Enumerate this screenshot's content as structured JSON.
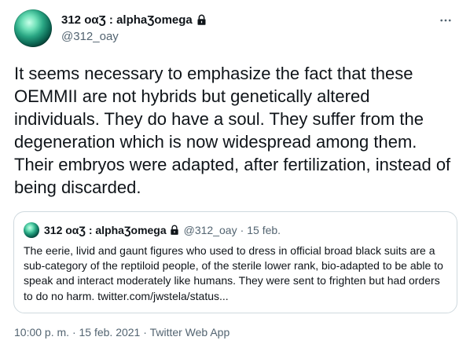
{
  "tweet": {
    "author": {
      "display_name": "312 οαƷ : alphaƷomega",
      "handle": "@312_oay",
      "locked": true
    },
    "more_icon": "more-horizontal-icon",
    "text": "It seems necessary to emphasize the fact that these OEMMII are not hybrids but genetically altered individuals. They do have a soul. They suffer from the degeneration which is now widespread among them. Their embryos were adapted, after fertilization, instead of being discarded.",
    "quoted": {
      "display_name": "312 οαƷ : alphaƷomega",
      "handle": "@312_oay",
      "separator": "·",
      "date": "15 feb.",
      "text": "The eerie, livid and gaunt figures who used to dress in official broad black suits are a sub-category of the reptiloid people, of the sterile lower rank, bio-adapted to be able to speak and interact moderately like humans. They were sent to frighten but had orders to do no harm. twitter.com/jwstela/status..."
    },
    "meta": {
      "time": "10:00 p. m.",
      "sep1": "·",
      "date": "15 feb. 2021",
      "sep2": "·",
      "source": "Twitter Web App"
    }
  },
  "colors": {
    "text": "#0f1419",
    "secondary": "#536471",
    "border": "#cfd9de"
  }
}
